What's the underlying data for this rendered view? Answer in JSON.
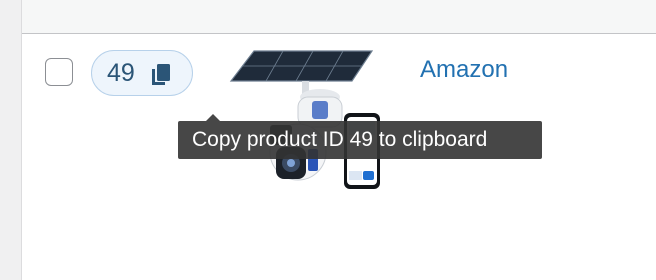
{
  "row": {
    "product_id": "49",
    "brand": "Amazon"
  },
  "tooltip": {
    "text": "Copy product ID 49 to clipboard"
  },
  "icons": {
    "copy": "copy-icon",
    "product_image": "solar-camera-thumbnail"
  },
  "colors": {
    "pill_background": "#eef5fc",
    "pill_border": "#b7d1ea",
    "link": "#2271b1",
    "tooltip_background": "#333333"
  }
}
